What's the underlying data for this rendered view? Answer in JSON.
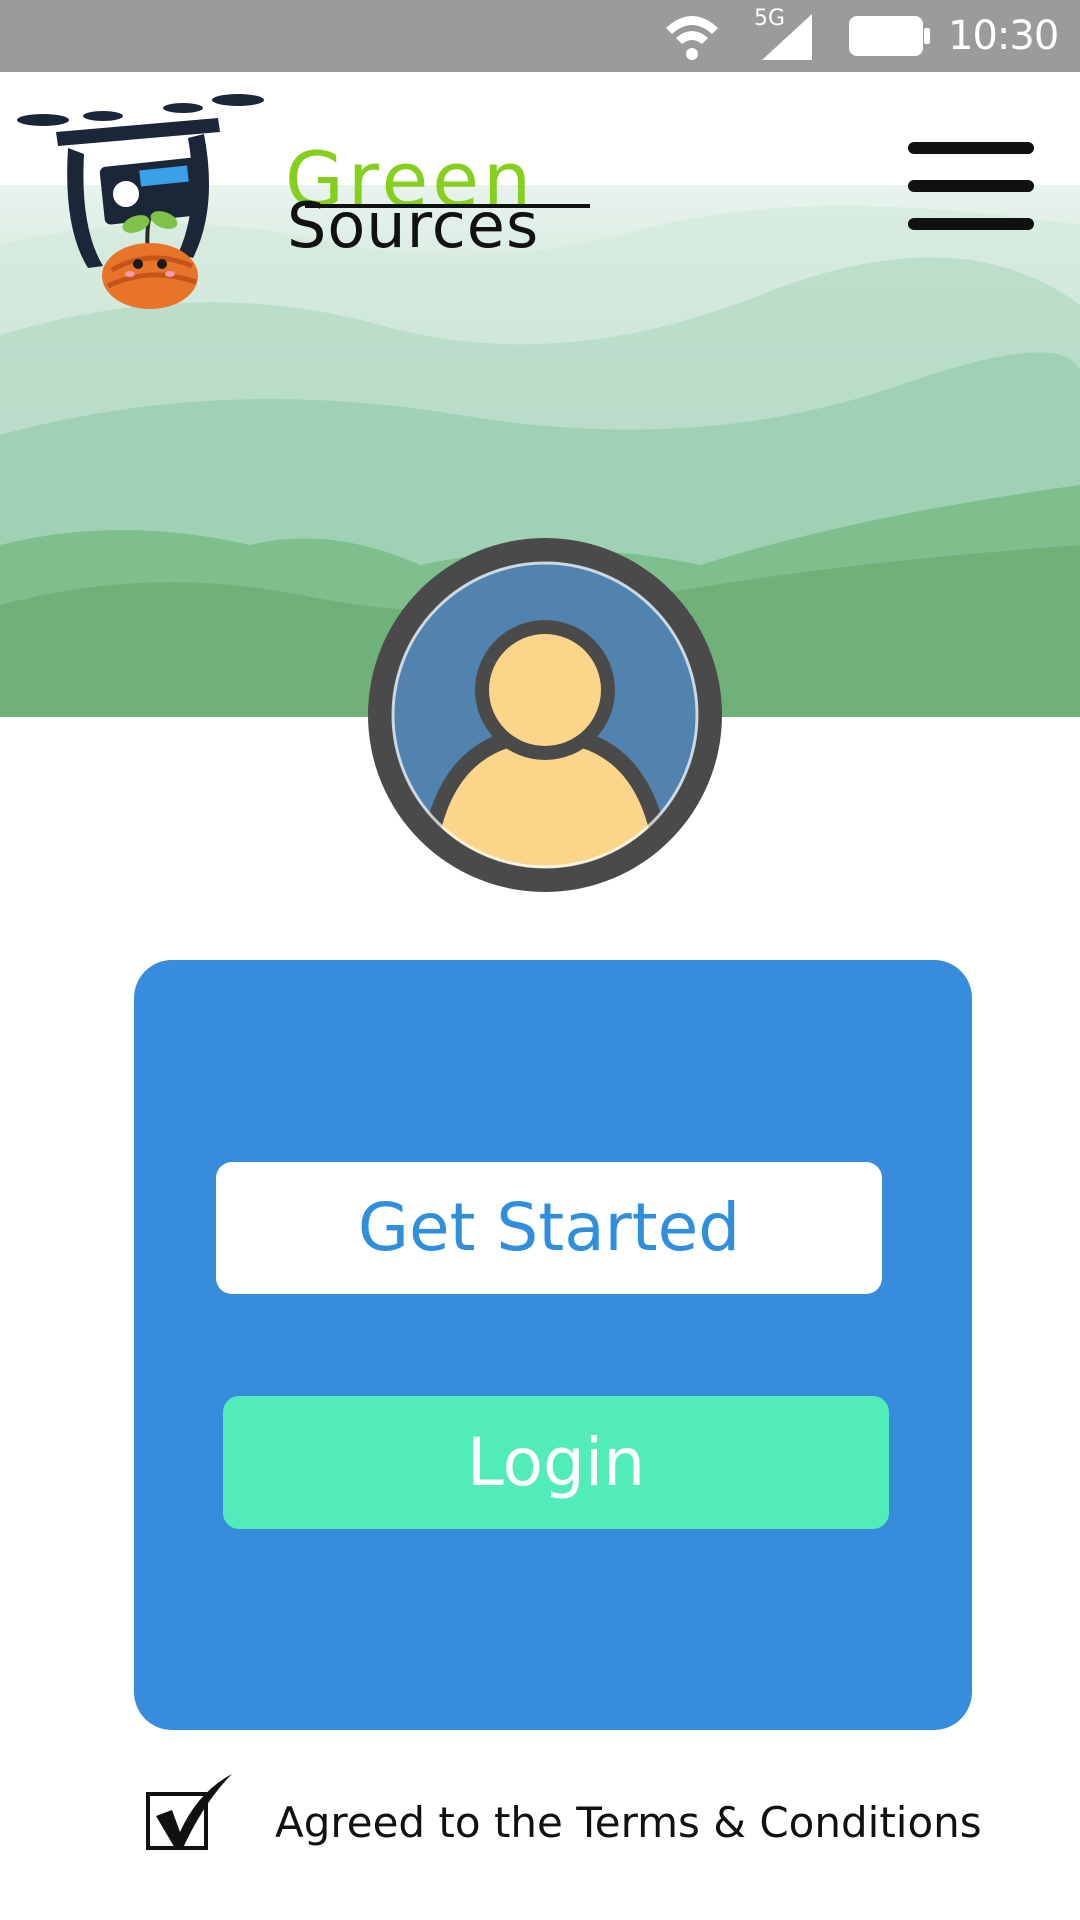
{
  "status_bar": {
    "network": "5G",
    "time": "10:30",
    "icons": [
      "wifi-icon",
      "signal-icon",
      "battery-icon"
    ]
  },
  "header": {
    "brand_line1": "Green",
    "brand_line2": "Sources",
    "menu_icon": "hamburger-menu-icon"
  },
  "profile": {
    "avatar_icon": "user-avatar-icon"
  },
  "card": {
    "get_started_label": "Get Started",
    "login_label": "Login"
  },
  "terms": {
    "checked": true,
    "label": "Agreed to the Terms & Conditions"
  },
  "colors": {
    "status_bar": "#9b9b9b",
    "card_blue": "#378ddb",
    "get_started_text": "#2f8fdc",
    "login_green": "#52ebba",
    "brand_green": "#86cf1f",
    "avatar_blue": "#5282ae",
    "avatar_skin": "#fbd68a"
  }
}
